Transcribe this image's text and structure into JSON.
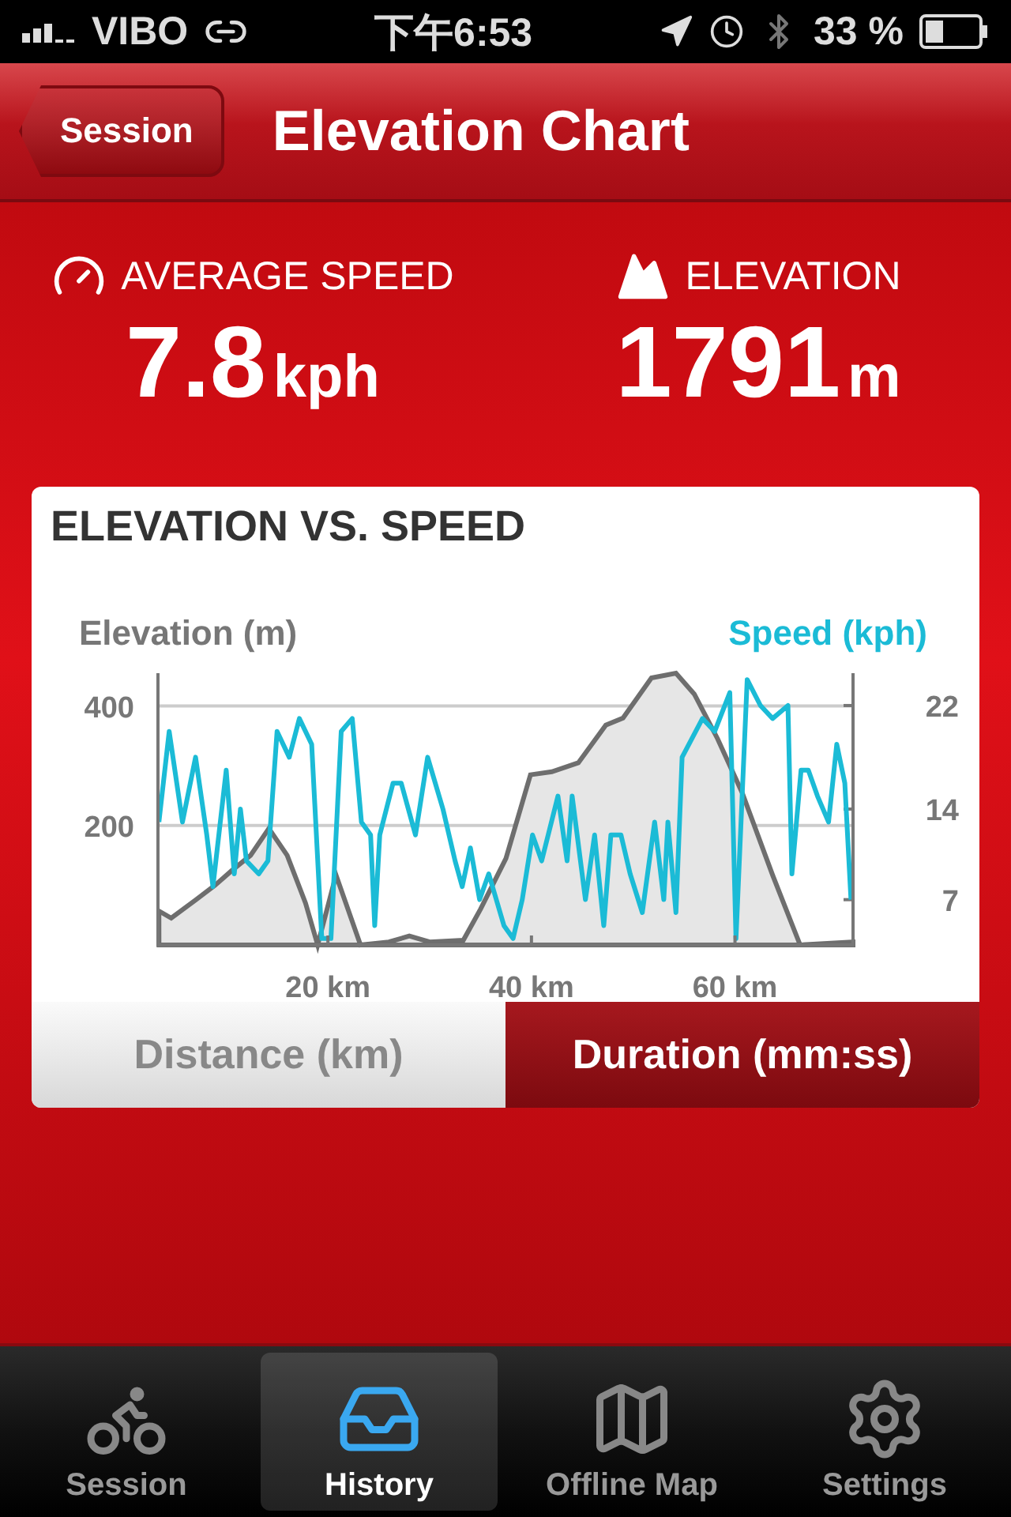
{
  "status_bar": {
    "carrier": "VIBO",
    "time": "下午6:53",
    "battery": "33 %"
  },
  "nav_bar": {
    "back_button": "Session",
    "title": "Elevation Chart"
  },
  "stats": [
    {
      "kind": "speed",
      "label": "AVERAGE SPEED",
      "value": "7.8",
      "unit": "kph"
    },
    {
      "kind": "elevation",
      "label": "ELEVATION",
      "value": "1791",
      "unit": "m"
    }
  ],
  "chart_card": {
    "title": "ELEVATION VS. SPEED",
    "chart_data": {
      "type": "line",
      "ylabel": "Elevation (m)",
      "y2label": "Speed (kph)",
      "xlim": [
        3.3,
        71.6
      ],
      "ylim": [
        0,
        455
      ],
      "y2lim": [
        3.5,
        24.5
      ],
      "xticks": [
        {
          "value": 20,
          "label": "20 km"
        },
        {
          "value": 40,
          "label": "40 km"
        },
        {
          "value": 60,
          "label": "60 km"
        }
      ],
      "yticks": [
        200,
        400
      ],
      "y2ticks": [
        7,
        14,
        22
      ],
      "series": [
        {
          "type": "area",
          "color": "#6e6e6e",
          "x": [
            3.4,
            4.6,
            7,
            8.9,
            10.6,
            12.4,
            14.2,
            16,
            17.8,
            19,
            20.8,
            23.2,
            26,
            28,
            30,
            33.3,
            35,
            37.5,
            39.9,
            42,
            44.6,
            47.3,
            49,
            51.8,
            54.2,
            56,
            58.3,
            60.7,
            63.7,
            66.4,
            71.6
          ],
          "values": [
            57,
            45,
            75,
            100,
            125,
            150,
            195,
            150,
            70,
            0,
            117,
            0,
            5,
            15,
            5,
            8,
            60,
            145,
            285,
            290,
            305,
            368,
            380,
            447,
            455,
            420,
            345,
            255,
            117,
            0,
            5
          ]
        },
        {
          "type": "line",
          "color": "#1bbbd6",
          "axis": "y2",
          "x": [
            3.4,
            4.4,
            5.7,
            7,
            8.1,
            8.7,
            10,
            10.8,
            11.4,
            12,
            13.2,
            14.1,
            15,
            16.2,
            17.2,
            18.4,
            19.4,
            20.3,
            21.3,
            22.4,
            23.3,
            24.2,
            24.6,
            25.1,
            26.4,
            27.2,
            28.6,
            29.8,
            31.3,
            32.5,
            33.2,
            34,
            34.9,
            35.8,
            37.3,
            38.2,
            39.1,
            40.1,
            41,
            42.6,
            43.5,
            44,
            45.3,
            46.2,
            47.1,
            47.8,
            48.8,
            49.7,
            50.9,
            52.1,
            53,
            53.4,
            54.2,
            54.8,
            56.8,
            58,
            59.5,
            60.1,
            61.2,
            62.5,
            63.7,
            65.2,
            65.6,
            66.5,
            67.2,
            68.1,
            69.2,
            70,
            70.8,
            71.4
          ],
          "values": [
            13,
            20,
            13,
            18,
            12,
            8,
            17,
            9,
            14,
            10,
            9,
            10,
            20,
            18,
            21,
            19,
            4,
            4,
            20,
            21,
            13,
            12,
            5,
            12,
            16,
            16,
            12,
            18,
            14,
            10,
            8,
            11,
            7,
            9,
            5,
            4,
            7,
            12,
            10,
            15,
            10,
            15,
            7,
            12,
            5,
            12,
            12,
            9,
            6,
            13,
            7,
            13,
            6,
            18,
            21,
            20,
            23,
            4,
            24,
            22,
            21,
            22,
            9,
            17,
            17,
            15,
            13,
            19,
            16,
            7
          ]
        }
      ]
    },
    "segments": [
      {
        "label": "Distance (km)",
        "selected": false
      },
      {
        "label": "Duration (mm:ss)",
        "selected": true
      }
    ]
  },
  "tab_bar": [
    {
      "kind": "session",
      "label": "Session",
      "selected": false
    },
    {
      "kind": "history",
      "label": "History",
      "selected": true
    },
    {
      "kind": "map",
      "label": "Offline Map",
      "selected": false
    },
    {
      "kind": "settings",
      "label": "Settings",
      "selected": false
    }
  ]
}
